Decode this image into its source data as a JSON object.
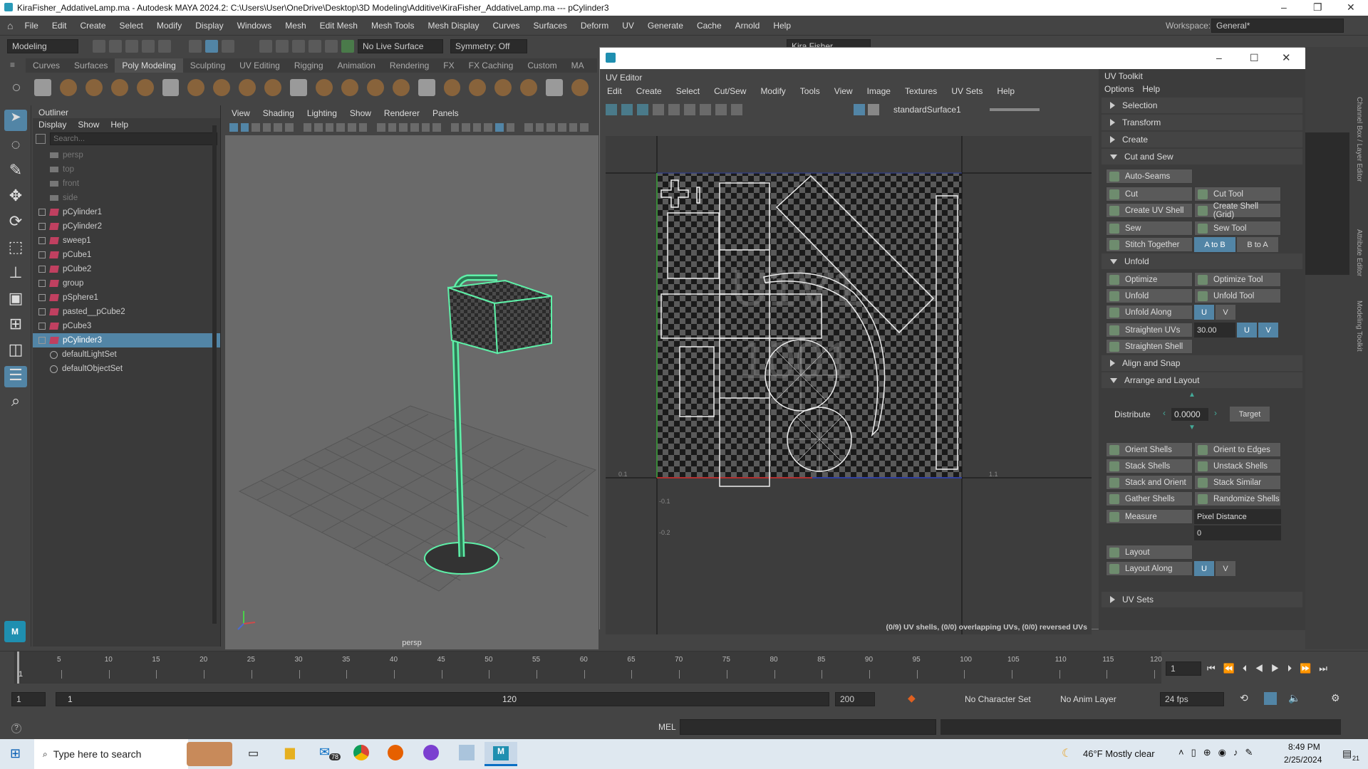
{
  "titlebar": {
    "title": "KiraFisher_AddativeLamp.ma - Autodesk MAYA 2024.2: C:\\Users\\User\\OneDrive\\Desktop\\3D Modeling\\Additive\\KiraFisher_AddativeLamp.ma  ---  pCylinder3"
  },
  "menubar": {
    "items": [
      "File",
      "Edit",
      "Create",
      "Select",
      "Modify",
      "Display",
      "Windows",
      "Mesh",
      "Edit Mesh",
      "Mesh Tools",
      "Mesh Display",
      "Curves",
      "Surfaces",
      "Deform",
      "UV",
      "Generate",
      "Cache",
      "Arnold",
      "Help"
    ],
    "workspace_label": "Workspace:",
    "workspace_value": "General*"
  },
  "statusline": {
    "mode": "Modeling",
    "live_surface": "No Live Surface",
    "symmetry": "Symmetry: Off",
    "user": "Kira Fisher"
  },
  "shelf": {
    "tabs": [
      "Curves",
      "Surfaces",
      "Poly Modeling",
      "Sculpting",
      "UV Editing",
      "Rigging",
      "Animation",
      "Rendering",
      "FX",
      "FX Caching",
      "Custom",
      "MA"
    ],
    "active": "Poly Modeling"
  },
  "outliner": {
    "title": "Outliner",
    "menu": [
      "Display",
      "Show",
      "Help"
    ],
    "search_placeholder": "Search...",
    "items": [
      {
        "label": "persp",
        "type": "camera"
      },
      {
        "label": "top",
        "type": "camera"
      },
      {
        "label": "front",
        "type": "camera"
      },
      {
        "label": "side",
        "type": "camera"
      },
      {
        "label": "pCylinder1",
        "type": "mesh"
      },
      {
        "label": "pCylinder2",
        "type": "mesh"
      },
      {
        "label": "sweep1",
        "type": "mesh"
      },
      {
        "label": "pCube1",
        "type": "mesh"
      },
      {
        "label": "pCube2",
        "type": "mesh"
      },
      {
        "label": "group",
        "type": "mesh"
      },
      {
        "label": "pSphere1",
        "type": "mesh"
      },
      {
        "label": "pasted__pCube2",
        "type": "mesh"
      },
      {
        "label": "pCube3",
        "type": "mesh"
      },
      {
        "label": "pCylinder3",
        "type": "mesh",
        "selected": true
      },
      {
        "label": "defaultLightSet",
        "type": "set"
      },
      {
        "label": "defaultObjectSet",
        "type": "set"
      }
    ]
  },
  "viewport": {
    "menu": [
      "View",
      "Shading",
      "Lighting",
      "Show",
      "Renderer",
      "Panels"
    ],
    "camera_label": "persp"
  },
  "uv_editor": {
    "title": "UV Editor",
    "menu": [
      "Edit",
      "Create",
      "Select",
      "Cut/Sew",
      "Modify",
      "Tools",
      "View",
      "Image",
      "Textures",
      "UV Sets",
      "Help"
    ],
    "material": "standardSurface1",
    "status": "(0/9) UV shells, (0/0) overlapping UVs, (0/0) reversed UVs",
    "tile_text": "U1V1",
    "tile_num": "1001",
    "axis_labels": [
      "0.1",
      "1.1",
      "-0.1",
      "-0.2"
    ]
  },
  "uv_toolkit": {
    "title": "UV Toolkit",
    "menu": [
      "Options",
      "Help"
    ],
    "sections": {
      "selection": "Selection",
      "transform": "Transform",
      "create": "Create",
      "cut_sew": "Cut and Sew",
      "unfold": "Unfold",
      "align": "Align and Snap",
      "arrange": "Arrange and Layout",
      "uvsets": "UV Sets"
    },
    "buttons": {
      "auto_seams": "Auto-Seams",
      "cut": "Cut",
      "cut_tool": "Cut Tool",
      "create_shell": "Create UV Shell",
      "create_shell_grid": "Create Shell (Grid)",
      "sew": "Sew",
      "sew_tool": "Sew Tool",
      "stitch": "Stitch Together",
      "a_to_b": "A to B",
      "b_to_a": "B to A",
      "optimize": "Optimize",
      "optimize_tool": "Optimize Tool",
      "unfold": "Unfold",
      "unfold_tool": "Unfold Tool",
      "unfold_along": "Unfold Along",
      "straighten_uvs": "Straighten UVs",
      "straighten_val": "30.00",
      "straighten_shell": "Straighten Shell",
      "distribute": "Distribute",
      "distribute_val": "0.0000",
      "target": "Target",
      "orient_shells": "Orient Shells",
      "orient_edges": "Orient to Edges",
      "stack_shells": "Stack Shells",
      "unstack_shells": "Unstack Shells",
      "stack_orient": "Stack and Orient",
      "stack_similar": "Stack Similar",
      "gather_shells": "Gather Shells",
      "randomize_shells": "Randomize Shells",
      "measure": "Measure",
      "measure_mode": "Pixel Distance",
      "measure_val": "0",
      "layout": "Layout",
      "layout_along": "Layout Along",
      "u": "U",
      "v": "V"
    }
  },
  "timeline": {
    "ticks": [
      "5",
      "10",
      "15",
      "20",
      "25",
      "30",
      "35",
      "40",
      "45",
      "50",
      "55",
      "60",
      "65",
      "70",
      "75",
      "80",
      "85",
      "90",
      "95",
      "100",
      "105",
      "110",
      "115",
      "120"
    ],
    "current_frame": "1",
    "start_marker": "1"
  },
  "range": {
    "start": "1",
    "inner_start": "1",
    "inner_end": "120",
    "end": "200",
    "character_set": "No Character Set",
    "anim_layer": "No Anim Layer",
    "fps": "24 fps"
  },
  "cmdline": {
    "lang": "MEL"
  },
  "taskbar": {
    "search_placeholder": "Type here to search",
    "mail_badge": "78",
    "weather": "46°F  Mostly clear",
    "time": "8:49 PM",
    "date": "2/25/2024",
    "notif": "21"
  },
  "rightbar": {
    "labels": [
      "Channel Box / Layer Editor",
      "Attribute Editor",
      "Modeling Toolkit"
    ]
  }
}
